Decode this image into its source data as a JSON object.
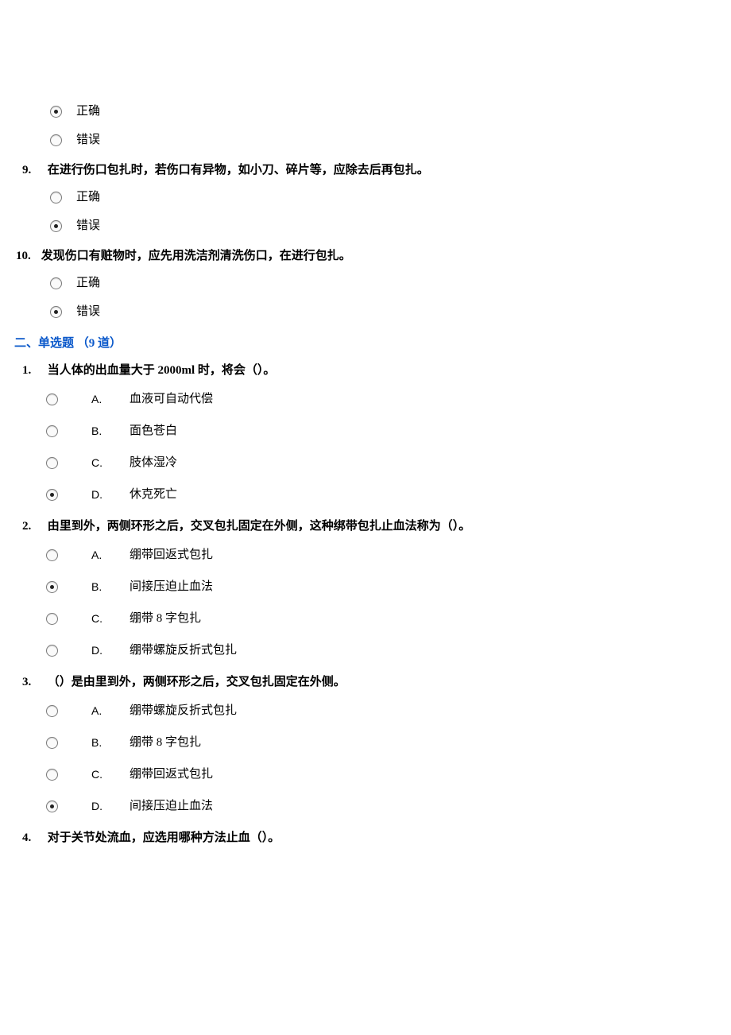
{
  "tf_partial": {
    "options": {
      "correct": "正确",
      "wrong": "错误"
    },
    "q8_selected": "correct",
    "q9": {
      "num": "9.",
      "text": "在进行伤口包扎时，若伤口有异物，如小刀、碎片等，应除去后再包扎。",
      "selected": "wrong"
    },
    "q10": {
      "num": "10.",
      "text": "发现伤口有赃物时，应先用洗洁剂清洗伤口，在进行包扎。",
      "selected": "wrong"
    }
  },
  "section2_header": "二、单选题 （9 道）",
  "mc": {
    "q1": {
      "num": "1.",
      "text": "当人体的出血量大于 2000ml 时，将会（）。",
      "options": [
        {
          "letter": "A.",
          "text": "血液可自动代偿"
        },
        {
          "letter": "B.",
          "text": "面色苍白"
        },
        {
          "letter": "C.",
          "text": "肢体湿冷"
        },
        {
          "letter": "D.",
          "text": "休克死亡"
        }
      ],
      "selected": 3
    },
    "q2": {
      "num": "2.",
      "text": "由里到外，两侧环形之后，交叉包扎固定在外侧，这种绑带包扎止血法称为（）。",
      "options": [
        {
          "letter": "A.",
          "text": "绷带回返式包扎"
        },
        {
          "letter": "B.",
          "text": "间接压迫止血法"
        },
        {
          "letter": "C.",
          "text": "绷带 8 字包扎"
        },
        {
          "letter": "D.",
          "text": "绷带螺旋反折式包扎"
        }
      ],
      "selected": 1
    },
    "q3": {
      "num": "3.",
      "text": "（）是由里到外，两侧环形之后，交叉包扎固定在外侧。",
      "options": [
        {
          "letter": "A.",
          "text": "绷带螺旋反折式包扎"
        },
        {
          "letter": "B.",
          "text": "绷带 8 字包扎"
        },
        {
          "letter": "C.",
          "text": "绷带回返式包扎"
        },
        {
          "letter": "D.",
          "text": "间接压迫止血法"
        }
      ],
      "selected": 3
    },
    "q4": {
      "num": "4.",
      "text": "对于关节处流血，应选用哪种方法止血（）。"
    }
  }
}
